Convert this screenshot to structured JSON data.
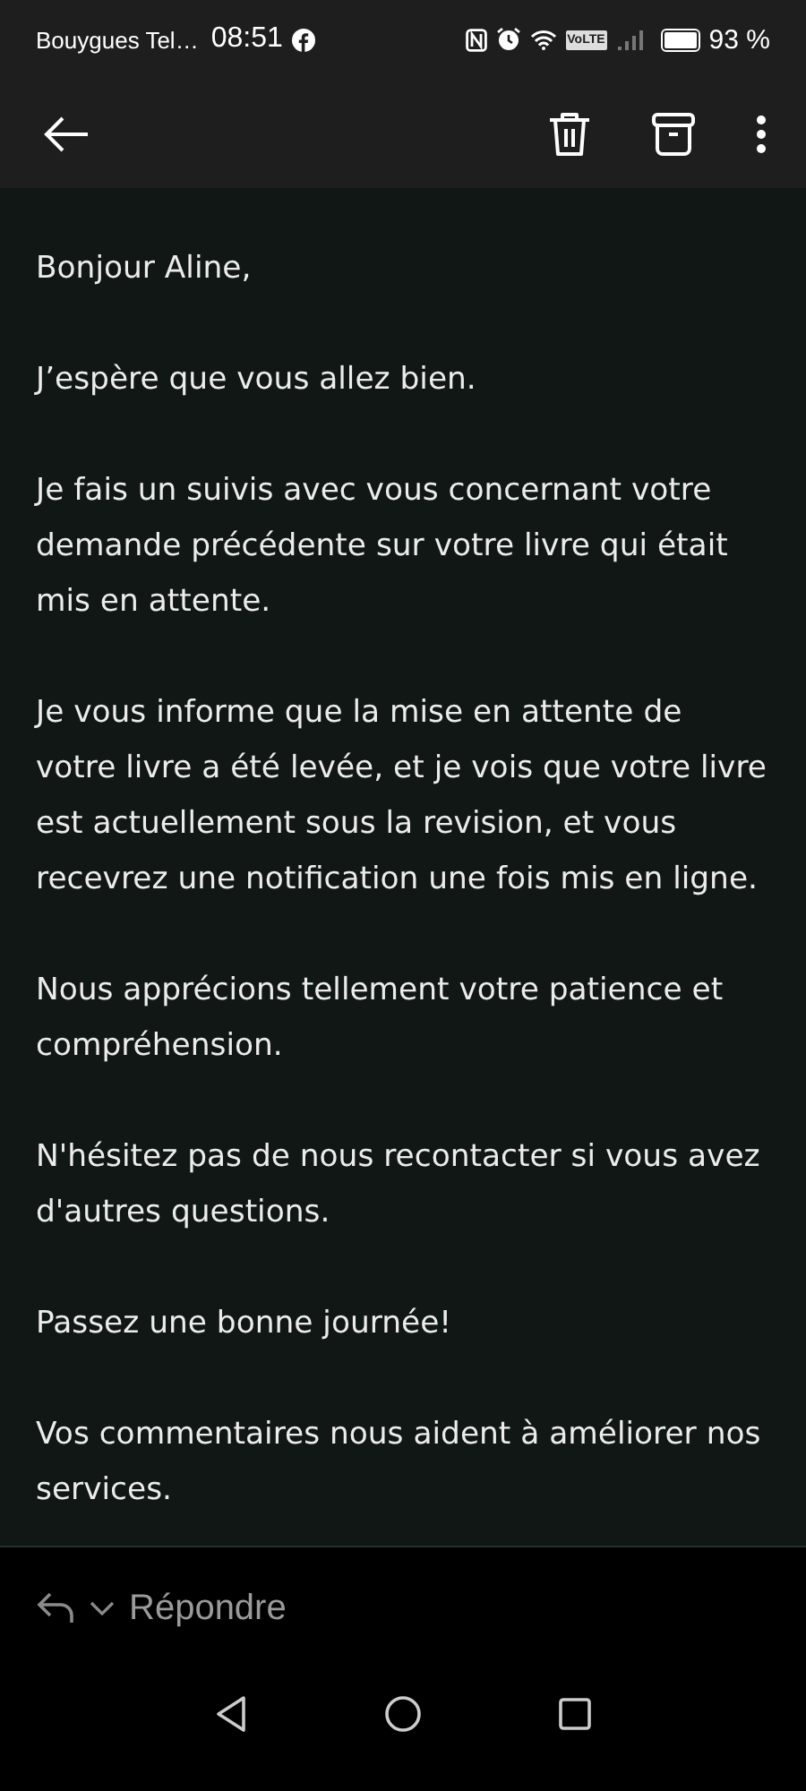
{
  "status_bar": {
    "carrier": "Bouygues Tel…",
    "time": "08:51",
    "volte": "VoLTE",
    "battery": "93 %"
  },
  "message": {
    "paragraphs": [
      "Bonjour Aline,",
      "J’espère que vous allez bien.",
      "Je fais un suivis avec vous concernant votre demande précédente sur votre livre qui était mis en attente.",
      "Je vous informe que la mise en attente de votre livre a été levée, et je vois que votre livre est actuellement sous la revision, et vous recevrez une notification une fois mis en ligne.",
      "Nous apprécions tellement votre patience et compréhension.",
      "N'hésitez pas de nous recontacter si vous avez d'autres questions.",
      "Passez une bonne journée!",
      "Vos commentaires nous aident à améliorer nos services."
    ]
  },
  "reply_bar": {
    "label": "Répondre"
  }
}
